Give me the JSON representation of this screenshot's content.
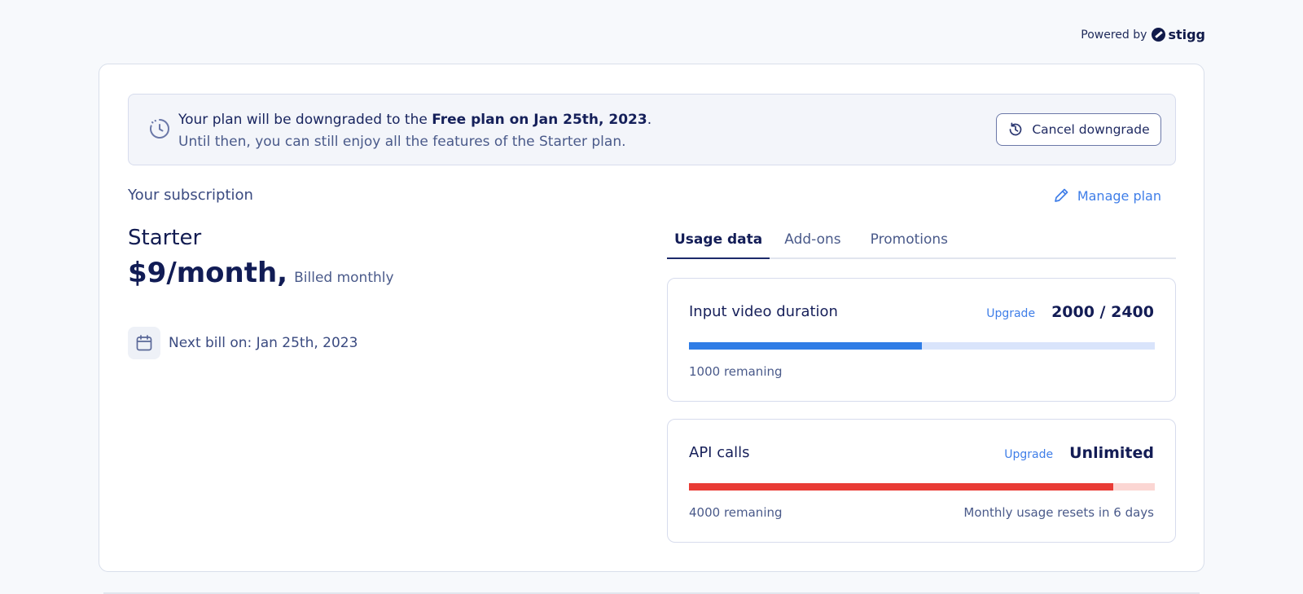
{
  "powered_by": {
    "label": "Powered by",
    "brand": "stigg"
  },
  "banner": {
    "line1_prefix": "Your plan will be downgraded to the ",
    "line1_bold": "Free plan on Jan 25th, 2023",
    "line1_suffix": ".",
    "line2": "Until then, you can still enjoy all the features of the Starter plan.",
    "cancel_label": "Cancel downgrade",
    "icon": "clock-icon"
  },
  "subscription": {
    "title": "Your subscription",
    "manage_label": "Manage plan",
    "plan_name": "Starter",
    "price": "$9/month,",
    "billing": "Billed monthly",
    "next_bill": "Next bill on: Jan 25th, 2023"
  },
  "tabs": [
    {
      "label": "Usage data",
      "active": true
    },
    {
      "label": "Add-ons",
      "active": false
    },
    {
      "label": "Promotions",
      "active": false
    }
  ],
  "usage": [
    {
      "title": "Input video duration",
      "upgrade": "Upgrade",
      "value": "2000 / 2400",
      "progress": 0.5,
      "remaining": "1000 remaning",
      "reset": "",
      "fill_color": "#2f7de6",
      "track_color": "#d9e4fb"
    },
    {
      "title": "API calls",
      "upgrade": "Upgrade",
      "value": "Unlimited",
      "progress": 0.91,
      "remaining": "4000 remaning",
      "reset": "Monthly usage resets in 6 days",
      "fill_color": "#e93b35",
      "track_color": "#fbd6d3"
    }
  ],
  "colors": {
    "accent": "#3f7ee8",
    "primary_text": "#131c55"
  }
}
